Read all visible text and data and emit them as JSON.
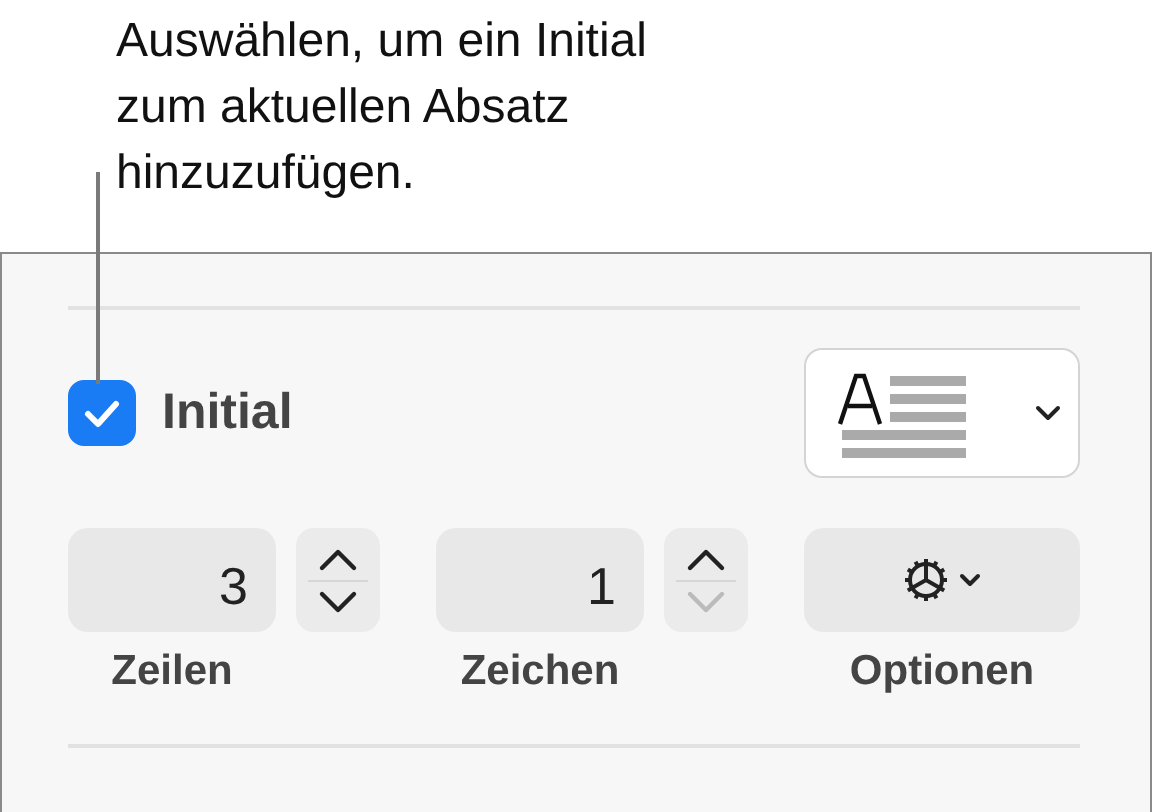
{
  "callout": "Auswählen, um ein Initial zum aktuellen Absatz hinzuzufügen.",
  "checkbox": {
    "label": "Initial",
    "checked": true
  },
  "fields": [
    {
      "value": "3",
      "label": "Zeilen",
      "up_disabled": false,
      "down_disabled": false
    },
    {
      "value": "1",
      "label": "Zeichen",
      "up_disabled": false,
      "down_disabled": true
    }
  ],
  "options": {
    "label": "Optionen"
  }
}
